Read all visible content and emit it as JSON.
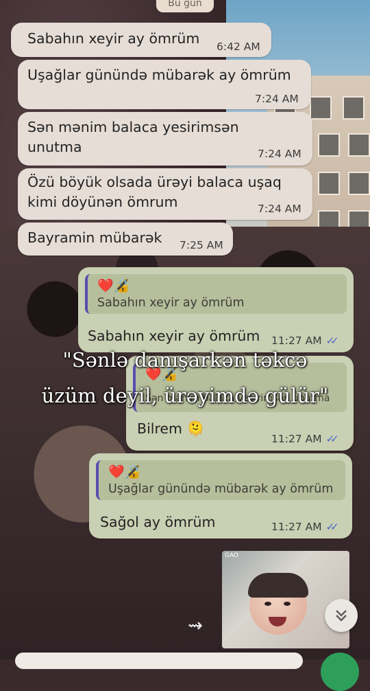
{
  "date_chip": "Bu gün",
  "incoming": [
    {
      "text": "Sabahın xeyir ay ömrüm",
      "time": "6:42 AM"
    },
    {
      "text": "Uşağlar günündə mübarək ay ömrüm",
      "time": "7:24 AM"
    },
    {
      "text_line1": "Sən mənim balaca yesirimsən",
      "text_line2": "unutma",
      "time": "7:24 AM"
    },
    {
      "text_line1": "Özü böyük olsada ürəyi balaca uşaq",
      "text_line2": "kimi döyünən ömrum",
      "time": "7:24 AM"
    },
    {
      "text": "Bayramin mübarək",
      "time": "7:25 AM"
    }
  ],
  "outgoing": [
    {
      "quote_emoji": "❤️🔏",
      "quote_text": "Sabahın xeyir ay ömrüm",
      "text": "Sabahın xeyir ay ömrüm",
      "time": "11:27 AM"
    },
    {
      "quote_emoji": "❤️🔏",
      "quote_text": "Sən mənim balaca yesirimsən unutma",
      "text": "Bilrem 🫠",
      "time": "11:27 AM"
    },
    {
      "quote_emoji": "❤️🔏",
      "quote_text": "Uşağlar günündə mübarək ay ömrüm",
      "text": "Sağol ay ömrüm",
      "time": "11:27 AM"
    }
  ],
  "ticks": "✓✓",
  "caption_line1": "\"Sənlə danışarkən təkcə",
  "caption_line2": "üzüm deyil, ürəyimdə gülür\"",
  "photo_watermark": "GAO",
  "icons": {
    "forward": "forward-icon",
    "scroll_down": "double-chevron-down-icon"
  },
  "colors": {
    "incoming_bubble": "#e6ddd6",
    "outgoing_bubble": "#c9d0b3",
    "quote_bar": "#5a4cae",
    "read_ticks": "#4a68c4"
  }
}
